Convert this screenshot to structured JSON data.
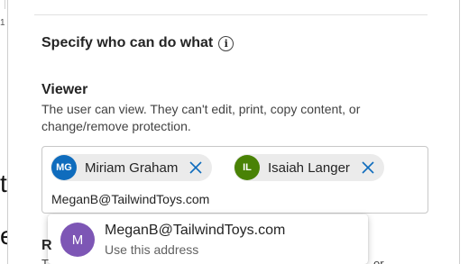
{
  "background": {
    "marker": "1",
    "big_text_1": "t",
    "big_text_2": "e"
  },
  "dialog": {
    "section_title": "Specify who can do what",
    "info_icon": "info-icon",
    "role": {
      "title": "Viewer",
      "description": "The user can view. They can't edit, print, copy content, or change/remove protection."
    },
    "people": [
      {
        "initials": "MG",
        "name": "Miriam Graham",
        "color": "#0f6cbd"
      },
      {
        "initials": "IL",
        "name": "Isaiah Langer",
        "color": "#498205"
      }
    ],
    "input": {
      "value": "MeganB@TailwindToys.com"
    },
    "suggestion": {
      "initial": "M",
      "primary": "MeganB@TailwindToys.com",
      "secondary": "Use this address",
      "color": "#7d56b5"
    },
    "next_role": {
      "title": "R",
      "description": "T",
      "description_tail": "or"
    }
  },
  "colors": {
    "remove_icon": "#0f6cbd",
    "chip_background": "#ebebeb",
    "border": "#c8c8c8"
  }
}
